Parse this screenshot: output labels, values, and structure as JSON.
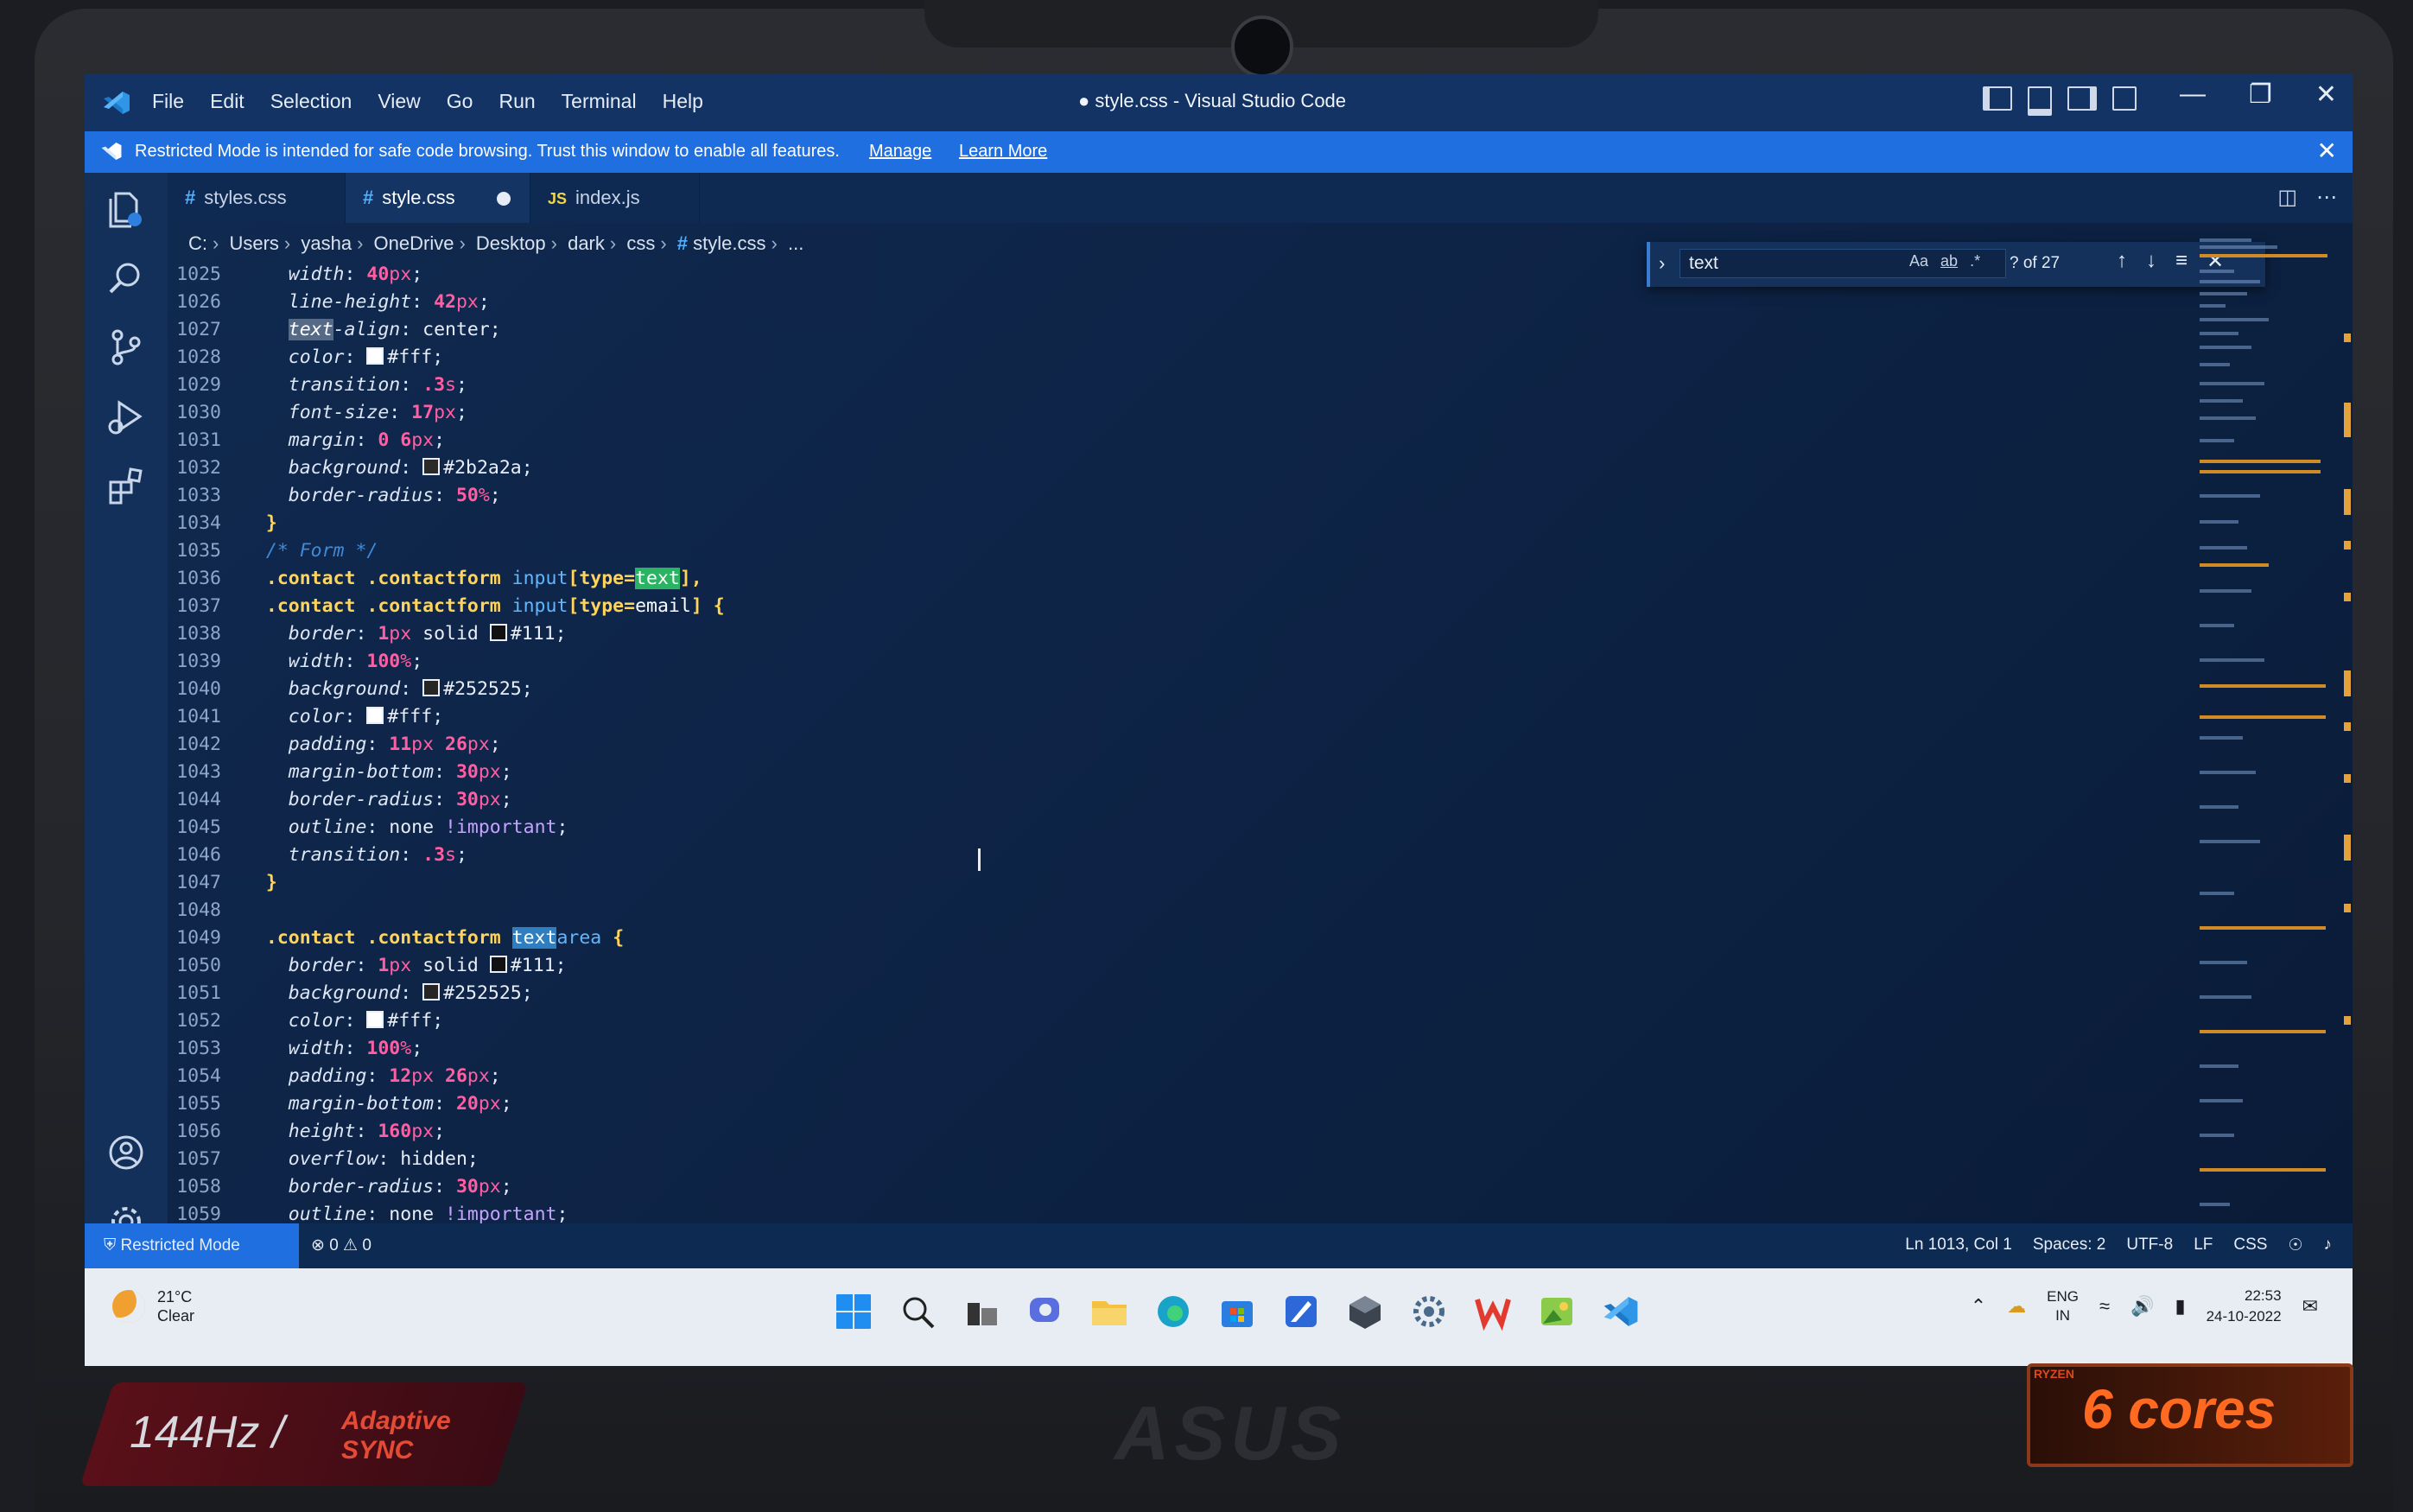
{
  "menu": [
    "File",
    "Edit",
    "Selection",
    "View",
    "Go",
    "Run",
    "Terminal",
    "Help"
  ],
  "window_title": "● style.css - Visual Studio Code",
  "banner": {
    "text": "Restricted Mode is intended for safe code browsing. Trust this window to enable all features.",
    "manage": "Manage",
    "learn_more": "Learn More"
  },
  "tabs": [
    {
      "label": "styles.css"
    },
    {
      "label": "style.css"
    },
    {
      "label": "index.js"
    }
  ],
  "breadcrumb": [
    "C:",
    "Users",
    "yasha",
    "OneDrive",
    "Desktop",
    "dark",
    "css",
    "style.css",
    "..."
  ],
  "find": {
    "query": "text",
    "count": "? of 27"
  },
  "code_lines": [
    {
      "n": "1025"
    },
    {
      "n": "1026"
    },
    {
      "n": "1027"
    },
    {
      "n": "1028"
    },
    {
      "n": "1029"
    },
    {
      "n": "1030"
    },
    {
      "n": "1031"
    },
    {
      "n": "1032"
    },
    {
      "n": "1033"
    },
    {
      "n": "1034"
    },
    {
      "n": "1035"
    },
    {
      "n": "1036"
    },
    {
      "n": "1037"
    },
    {
      "n": "1038"
    },
    {
      "n": "1039"
    },
    {
      "n": "1040"
    },
    {
      "n": "1041"
    },
    {
      "n": "1042"
    },
    {
      "n": "1043"
    },
    {
      "n": "1044"
    },
    {
      "n": "1045"
    },
    {
      "n": "1046"
    },
    {
      "n": "1047"
    },
    {
      "n": "1048"
    },
    {
      "n": "1049"
    },
    {
      "n": "1050"
    },
    {
      "n": "1051"
    },
    {
      "n": "1052"
    },
    {
      "n": "1053"
    },
    {
      "n": "1054"
    },
    {
      "n": "1055"
    },
    {
      "n": "1056"
    },
    {
      "n": "1057"
    },
    {
      "n": "1058"
    },
    {
      "n": "1059"
    }
  ],
  "code": {
    "l1025": {
      "prop": "width",
      "num": "40",
      "unit": "px"
    },
    "l1026": {
      "prop": "line-height",
      "num": "42",
      "unit": "px"
    },
    "l1027": {
      "hl": "text",
      "prop": "-align",
      "val": "center"
    },
    "l1028": {
      "prop": "color",
      "val": "#fff"
    },
    "l1029": {
      "prop": "transition",
      "num": ".3",
      "unit": "s"
    },
    "l1030": {
      "prop": "font-size",
      "num": "17",
      "unit": "px"
    },
    "l1031": {
      "prop": "margin",
      "num1": "0",
      "num2": "6",
      "unit": "px"
    },
    "l1032": {
      "prop": "background",
      "val": "#2b2a2a"
    },
    "l1033": {
      "prop": "border-radius",
      "num": "50",
      "unit": "%"
    },
    "l1034": {
      "brace": "}"
    },
    "l1035": {
      "comment": "/* Form */"
    },
    "l1036": {
      "sel": ".contact .contactform",
      "tag": "input",
      "attr": "[type=",
      "match": "text",
      "end": "],"
    },
    "l1037": {
      "sel": ".contact .contactform",
      "tag": "input",
      "attr": "[type=",
      "val": "email",
      "end": "] {"
    },
    "l1038": {
      "prop": "border",
      "num": "1",
      "unit": "px",
      "val": "solid",
      "color": "#111"
    },
    "l1039": {
      "prop": "width",
      "num": "100",
      "unit": "%"
    },
    "l1040": {
      "prop": "background",
      "val": "#252525"
    },
    "l1041": {
      "prop": "color",
      "val": "#fff"
    },
    "l1042": {
      "prop": "padding",
      "num1": "11",
      "num2": "26",
      "unit": "px"
    },
    "l1043": {
      "prop": "margin-bottom",
      "num": "30",
      "unit": "px"
    },
    "l1044": {
      "prop": "border-radius",
      "num": "30",
      "unit": "px"
    },
    "l1045": {
      "prop": "outline",
      "val": "none",
      "kw": "!important"
    },
    "l1046": {
      "prop": "transition",
      "num": ".3",
      "unit": "s"
    },
    "l1047": {
      "brace": "}"
    },
    "l1049": {
      "sel": ".contact .contactform",
      "match": "text",
      "tag": "area",
      "end": "{"
    },
    "l1050": {
      "prop": "border",
      "num": "1",
      "unit": "px",
      "val": "solid",
      "color": "#111"
    },
    "l1051": {
      "prop": "background",
      "val": "#252525"
    },
    "l1052": {
      "prop": "color",
      "val": "#fff"
    },
    "l1053": {
      "prop": "width",
      "num": "100",
      "unit": "%"
    },
    "l1054": {
      "prop": "padding",
      "num1": "12",
      "num2": "26",
      "unit": "px"
    },
    "l1055": {
      "prop": "margin-bottom",
      "num": "20",
      "unit": "px"
    },
    "l1056": {
      "prop": "height",
      "num": "160",
      "unit": "px"
    },
    "l1057": {
      "prop": "overflow",
      "val": "hidden"
    },
    "l1058": {
      "prop": "border-radius",
      "num": "30",
      "unit": "px"
    },
    "l1059": {
      "prop": "outline",
      "val": "none",
      "kw": "!important"
    }
  },
  "status": {
    "restricted": "Restricted Mode",
    "problems": "⊗ 0 ⚠ 0",
    "cursor": "Ln 1013, Col 1",
    "spaces": "Spaces: 2",
    "encoding": "UTF-8",
    "eol": "LF",
    "language": "CSS"
  },
  "taskbar": {
    "temp": "21°C",
    "weather": "Clear",
    "lang1": "ENG",
    "lang2": "IN",
    "time": "22:53",
    "date": "24-10-2022"
  },
  "stickers": {
    "hz": "144Hz /",
    "adaptive": "Adaptive",
    "sync": "SYNC",
    "brand": "ASUS",
    "ryzen": "RYZEN",
    "cores": "6 cores"
  },
  "colors": {
    "accent": "#1f6fe0",
    "editor_bg": "#0e2447",
    "find_match": "#2bb364"
  }
}
